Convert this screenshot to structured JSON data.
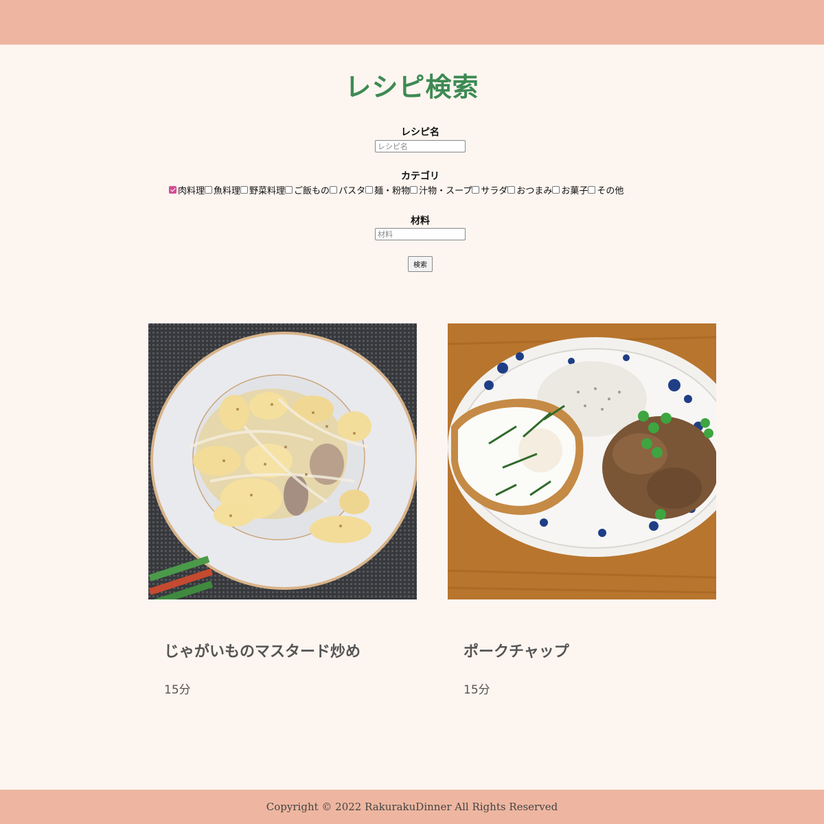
{
  "header": {
    "title": "レシピ検索"
  },
  "search": {
    "name_label": "レシピ名",
    "name_placeholder": "レシピ名",
    "category_label": "カテゴリ",
    "categories": [
      {
        "label": "肉料理",
        "checked": true
      },
      {
        "label": "魚料理",
        "checked": false
      },
      {
        "label": "野菜料理",
        "checked": false
      },
      {
        "label": "ご飯もの",
        "checked": false
      },
      {
        "label": "パスタ",
        "checked": false
      },
      {
        "label": "麺・粉物",
        "checked": false
      },
      {
        "label": "汁物・スープ",
        "checked": false
      },
      {
        "label": "サラダ",
        "checked": false
      },
      {
        "label": "おつまみ",
        "checked": false
      },
      {
        "label": "お菓子",
        "checked": false
      },
      {
        "label": "その他",
        "checked": false
      }
    ],
    "ingredient_label": "材料",
    "ingredient_placeholder": "材料",
    "button_label": "検索"
  },
  "results": [
    {
      "title": "じゃがいものマスタード炒め",
      "time": "15分"
    },
    {
      "title": "ポークチャップ",
      "time": "15分"
    }
  ],
  "footer": {
    "copyright": "Copyright © 2022 RakurakuDinner All Rights Reserved"
  },
  "colors": {
    "header_bg": "#eeb6a0",
    "title_green": "#3d8a53",
    "page_bg": "#fdf5f0",
    "checkbox_accent": "#d64b93"
  }
}
